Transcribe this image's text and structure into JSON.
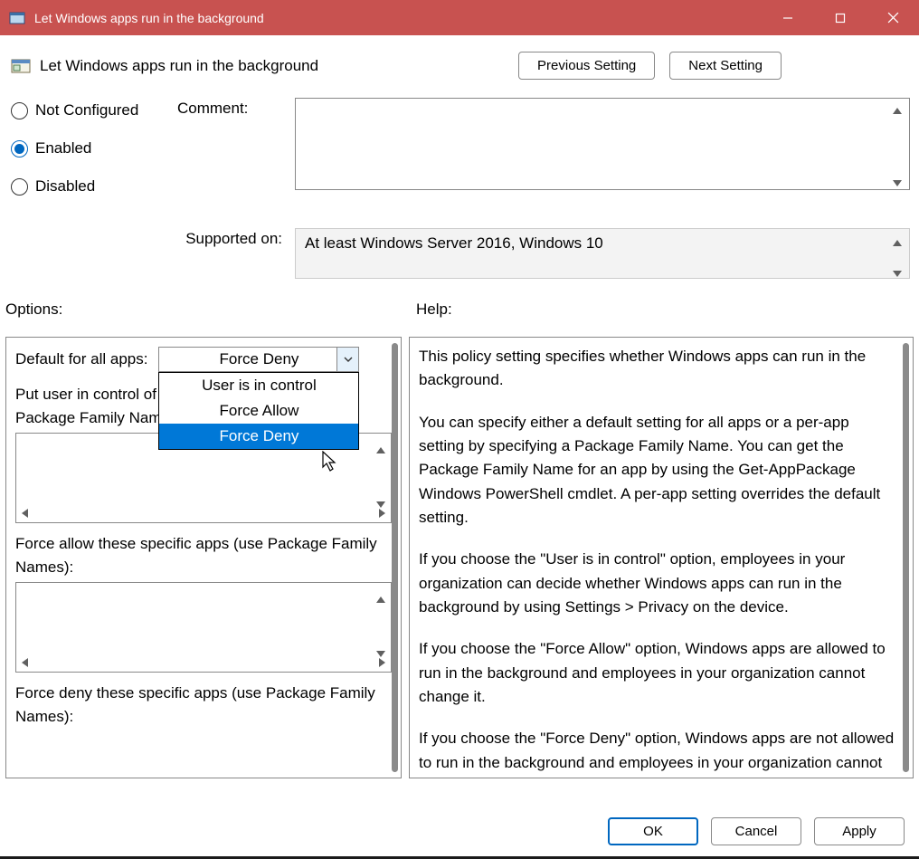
{
  "titlebar": {
    "title": "Let Windows apps run in the background"
  },
  "header": {
    "policy_title": "Let Windows apps run in the background",
    "prev_btn": "Previous Setting",
    "next_btn": "Next Setting"
  },
  "state": {
    "not_configured": "Not Configured",
    "enabled": "Enabled",
    "disabled": "Disabled",
    "selected": "Enabled"
  },
  "fields": {
    "comment_label": "Comment:",
    "supported_label": "Supported on:",
    "supported_value": "At least Windows Server 2016, Windows 10"
  },
  "sections": {
    "options": "Options:",
    "help": "Help:"
  },
  "options": {
    "default_label": "Default for all apps:",
    "combo_value": "Force Deny",
    "combo_items": [
      "User is in control",
      "Force Allow",
      "Force Deny"
    ],
    "combo_selected": "Force Deny",
    "put_user_line1": "Put user in control of these specific apps (use",
    "put_user_line2": "Package Family Names):",
    "force_allow_line1": "Force allow these specific apps (use Package Family",
    "force_allow_line2": "Names):",
    "force_deny_line1": "Force deny these specific apps (use Package Family",
    "force_deny_line2": "Names):"
  },
  "help": {
    "p1": "This policy setting specifies whether Windows apps can run in the background.",
    "p2": "You can specify either a default setting for all apps or a per-app setting by specifying a Package Family Name. You can get the Package Family Name for an app by using the Get-AppPackage Windows PowerShell cmdlet. A per-app setting overrides the default setting.",
    "p3": "If you choose the \"User is in control\" option, employees in your organization can decide whether Windows apps can run in the background by using Settings > Privacy on the device.",
    "p4": "If you choose the \"Force Allow\" option, Windows apps are allowed to run in the background and employees in your organization cannot change it.",
    "p5": "If you choose the \"Force Deny\" option, Windows apps are not allowed to run in the background and employees in your organization cannot change it."
  },
  "footer": {
    "ok": "OK",
    "cancel": "Cancel",
    "apply": "Apply"
  }
}
